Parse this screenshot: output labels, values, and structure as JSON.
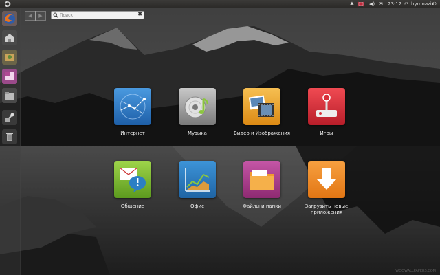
{
  "topbar": {
    "clock": "23:12",
    "user": "hymnazix"
  },
  "search": {
    "placeholder": "Поиск",
    "value": ""
  },
  "tiles": [
    {
      "label": "Интернет"
    },
    {
      "label": "Музыка"
    },
    {
      "label": "Видео и Изображения"
    },
    {
      "label": "Игры"
    },
    {
      "label": "Общение"
    },
    {
      "label": "Офис"
    },
    {
      "label": "Файлы и папки"
    },
    {
      "label": "Загрузить новые приложения"
    }
  ],
  "colors": {
    "internet": "#2a78c8",
    "music": "#9a9a9a",
    "video": "#e8a020",
    "games": "#d8303a",
    "communication": "#7cb82e",
    "office": "#2c7fc4",
    "files": "#b33d8e",
    "download": "#f28a1e"
  },
  "watermark": "WOOWALLPAPERS.COM"
}
